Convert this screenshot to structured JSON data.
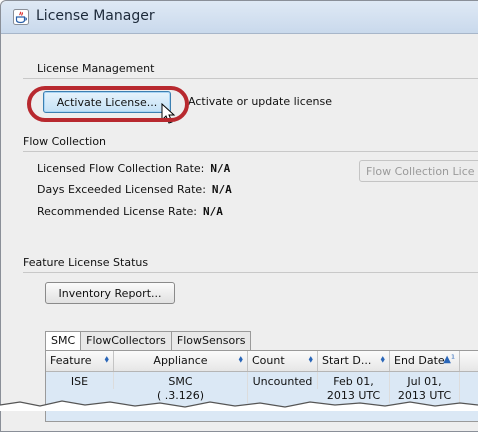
{
  "window": {
    "title": "License Manager"
  },
  "license_management": {
    "section_label": "License Management",
    "activate_button": "Activate License...",
    "activate_desc": "Activate or update license"
  },
  "flow_collection": {
    "section_label": "Flow Collection",
    "rows": [
      {
        "label": "Licensed Flow Collection Rate:",
        "value": "N/A"
      },
      {
        "label": "Days Exceeded Licensed Rate:",
        "value": "N/A"
      },
      {
        "label": "Recommended License Rate:",
        "value": "N/A"
      }
    ],
    "flow_button": "Flow Collection Lice"
  },
  "feature_license": {
    "section_label": "Feature License Status",
    "inventory_button": "Inventory Report..."
  },
  "tabs": [
    "SMC",
    "FlowCollectors",
    "FlowSensors"
  ],
  "table": {
    "headers": [
      "Feature",
      "Appliance",
      "Count",
      "Start D...",
      "End Date"
    ],
    "sort_marks": [
      "⬧",
      "⬧",
      "⬧",
      "⬧",
      "▲¹"
    ],
    "row": {
      "feature": "ISE",
      "appliance_line1": "SMC",
      "appliance_line2": "(        .3.126)",
      "count": "Uncounted",
      "start_line1": "Feb 01,",
      "start_line2": "2013 UTC",
      "end_line1": "Jul 01,",
      "end_line2": "2013 UTC"
    }
  },
  "colors": {
    "highlight_ring": "#b8292f",
    "titlebar": "#c9d9ec",
    "selected_row": "#dbe8f5"
  }
}
